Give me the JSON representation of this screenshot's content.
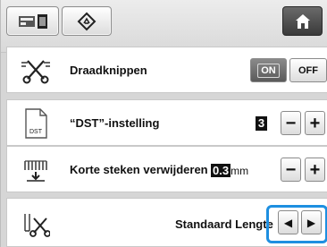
{
  "toolbar": {
    "embroidery_icon": "embroidery-machine-icon",
    "settings_icon": "settings-diamond-icon",
    "home_icon": "home-icon"
  },
  "rows": {
    "thread_cut": {
      "label": "Draadknippen",
      "icon": "scissors-icon",
      "on_label": "ON",
      "off_label": "OFF",
      "selected": "ON"
    },
    "dst": {
      "label": "“DST”-instelling",
      "icon": "dst-file-icon",
      "file_text": "DST",
      "value": "3",
      "minus": "−",
      "plus": "+"
    },
    "short_stitch": {
      "label": "Korte steken verwijderen",
      "icon": "short-stitch-icon",
      "value": "0.3",
      "unit": "mm",
      "minus": "−",
      "plus": "+"
    },
    "thread_length": {
      "label": "Standaard Lengte",
      "icon": "thread-cut-length-icon",
      "left": "◀",
      "right": "▶"
    }
  },
  "colors": {
    "highlight": "#1e8fe0"
  }
}
